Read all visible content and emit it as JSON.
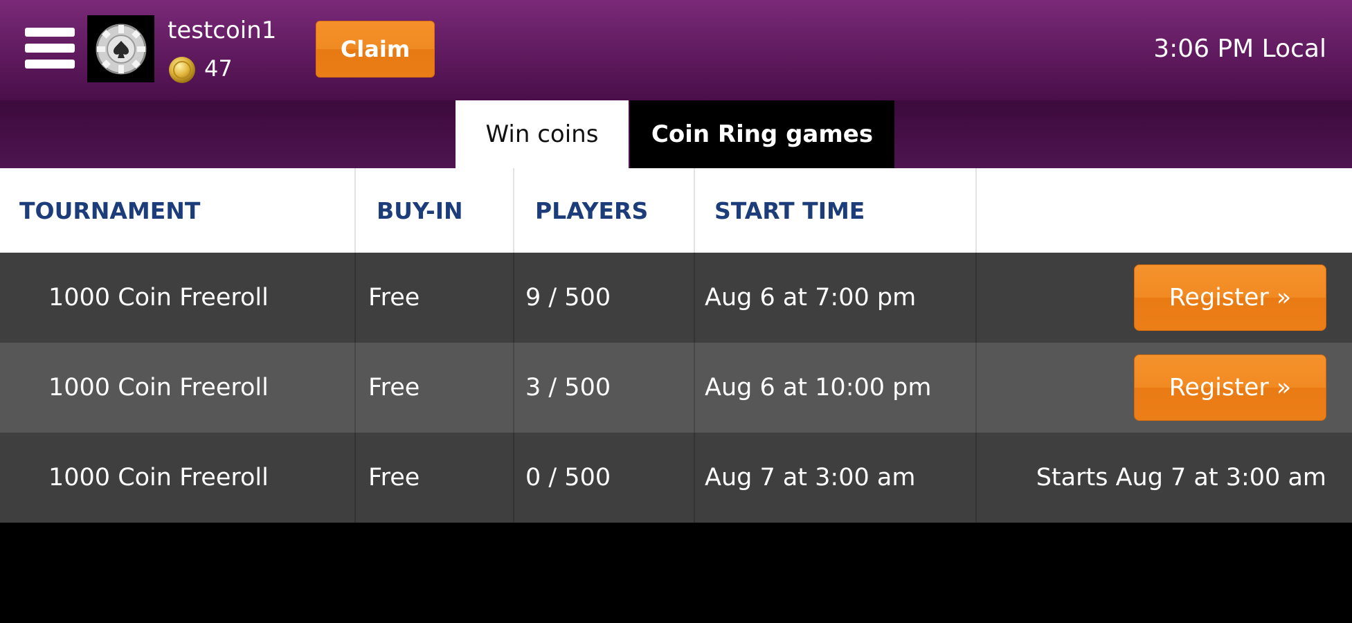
{
  "header": {
    "username": "testcoin1",
    "coin_balance": "47",
    "claim_label": "Claim",
    "local_time": "3:06 PM Local"
  },
  "tabs": [
    {
      "label": "Win coins",
      "active": true
    },
    {
      "label": "Coin Ring games",
      "active": false
    }
  ],
  "table": {
    "columns": [
      "TOURNAMENT",
      "BUY-IN",
      "PLAYERS",
      "START TIME"
    ],
    "rows": [
      {
        "tournament": "1000 Coin Freeroll",
        "buyin": "Free",
        "players": "9 / 500",
        "start_time": "Aug 6 at 7:00 pm",
        "action": "Register »"
      },
      {
        "tournament": "1000 Coin Freeroll",
        "buyin": "Free",
        "players": "3 / 500",
        "start_time": "Aug 6 at 10:00 pm",
        "action": "Register »"
      },
      {
        "tournament": "1000 Coin Freeroll",
        "buyin": "Free",
        "players": "0 / 500",
        "start_time": "Aug 7 at 3:00 am",
        "action": "Starts Aug 7 at 3:00 am"
      }
    ]
  },
  "colors": {
    "header_purple": "#7a2a78",
    "accent_orange": "#f08a22",
    "column_header_text": "#1d3d7a"
  },
  "icons": {
    "menu": "hamburger-icon",
    "avatar": "poker-chip-icon",
    "coin": "coin-icon"
  }
}
